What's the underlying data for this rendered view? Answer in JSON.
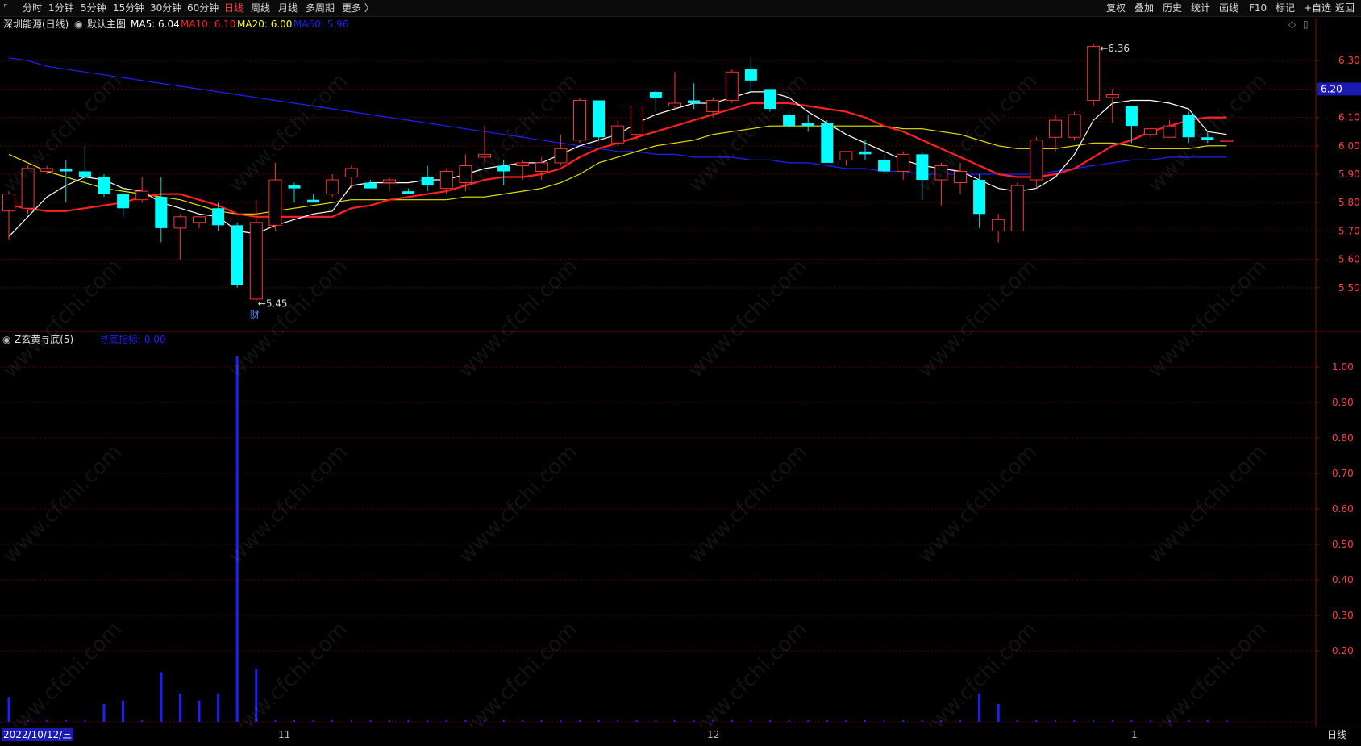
{
  "toolbar": {
    "periods": [
      "分时",
      "1分钟",
      "5分钟",
      "15分钟",
      "30分钟",
      "60分钟",
      "日线",
      "周线",
      "月线",
      "多周期",
      "更多 〉"
    ],
    "active_period": "日线",
    "right_buttons": [
      "复权",
      "叠加",
      "历史",
      "统计",
      "画线",
      "F10",
      "标记",
      "+自选",
      "返回"
    ],
    "corner_icon": "corner-marker-icon"
  },
  "main_panel": {
    "stock_name": "深圳能源(日线)",
    "template_name": "默认主图",
    "ma_labels": [
      {
        "text": "MA5: 6.04",
        "color": "#ffffff"
      },
      {
        "text": "MA10: 6.10",
        "color": "#ff2020"
      },
      {
        "text": "MA20: 6.00",
        "color": "#ffff00"
      },
      {
        "text": "MA60: 5.96",
        "color": "#1e1eff"
      }
    ],
    "price_ticks": [
      "6.30",
      "6.20",
      "6.10",
      "6.00",
      "5.90",
      "5.80",
      "5.70",
      "5.60",
      "5.50"
    ],
    "current_price": "6.20",
    "high_marker": "6.36",
    "low_marker": "5.45",
    "event_marker": "财"
  },
  "indicator_panel": {
    "title": "Z玄黄寻底(5)",
    "series_label": "寻底指标: 0.00",
    "ticks": [
      "1.00",
      "0.90",
      "0.80",
      "0.70",
      "0.60",
      "0.50",
      "0.40",
      "0.30",
      "0.20"
    ]
  },
  "bottom": {
    "start_date": "2022/10/12/三",
    "month_labels": [
      "11",
      "12",
      "1"
    ],
    "period_label": "日线"
  },
  "watermark": "www.cfchi.com",
  "colors": {
    "up": "#ff3232",
    "down": "#00ffff",
    "ma5": "#ffffff",
    "ma10": "#ff2020",
    "ma20": "#e6e600",
    "ma60": "#2020ff",
    "indicator": "#1e1eff",
    "grid": "#5a0000",
    "axis": "#8a0a0a"
  },
  "chart_data": {
    "type": "candlestick",
    "price_range": [
      5.4,
      6.4
    ],
    "indicator_range": [
      0,
      1.05
    ],
    "candles": [
      {
        "o": 5.77,
        "h": 5.84,
        "l": 5.67,
        "c": 5.83
      },
      {
        "o": 5.78,
        "h": 5.93,
        "l": 5.76,
        "c": 5.92
      },
      {
        "o": 5.91,
        "h": 5.93,
        "l": 5.9,
        "c": 5.92
      },
      {
        "o": 5.92,
        "h": 5.95,
        "l": 5.8,
        "c": 5.91
      },
      {
        "o": 5.91,
        "h": 6.0,
        "l": 5.86,
        "c": 5.89
      },
      {
        "o": 5.89,
        "h": 5.9,
        "l": 5.82,
        "c": 5.83
      },
      {
        "o": 5.83,
        "h": 5.84,
        "l": 5.75,
        "c": 5.78
      },
      {
        "o": 5.81,
        "h": 5.89,
        "l": 5.8,
        "c": 5.84
      },
      {
        "o": 5.82,
        "h": 5.89,
        "l": 5.66,
        "c": 5.71
      },
      {
        "o": 5.71,
        "h": 5.76,
        "l": 5.6,
        "c": 5.75
      },
      {
        "o": 5.73,
        "h": 5.75,
        "l": 5.71,
        "c": 5.75
      },
      {
        "o": 5.78,
        "h": 5.8,
        "l": 5.7,
        "c": 5.72
      },
      {
        "o": 5.72,
        "h": 5.73,
        "l": 5.5,
        "c": 5.51
      },
      {
        "o": 5.46,
        "h": 5.81,
        "l": 5.45,
        "c": 5.73
      },
      {
        "o": 5.72,
        "h": 5.94,
        "l": 5.7,
        "c": 5.88
      },
      {
        "o": 5.86,
        "h": 5.87,
        "l": 5.8,
        "c": 5.85
      },
      {
        "o": 5.81,
        "h": 5.83,
        "l": 5.8,
        "c": 5.8
      },
      {
        "o": 5.83,
        "h": 5.9,
        "l": 5.82,
        "c": 5.88
      },
      {
        "o": 5.89,
        "h": 5.93,
        "l": 5.85,
        "c": 5.92
      },
      {
        "o": 5.87,
        "h": 5.88,
        "l": 5.85,
        "c": 5.85
      },
      {
        "o": 5.87,
        "h": 5.89,
        "l": 5.84,
        "c": 5.88
      },
      {
        "o": 5.84,
        "h": 5.85,
        "l": 5.83,
        "c": 5.83
      },
      {
        "o": 5.89,
        "h": 5.93,
        "l": 5.84,
        "c": 5.86
      },
      {
        "o": 5.85,
        "h": 5.92,
        "l": 5.83,
        "c": 5.91
      },
      {
        "o": 5.87,
        "h": 5.97,
        "l": 5.84,
        "c": 5.93
      },
      {
        "o": 5.96,
        "h": 6.07,
        "l": 5.94,
        "c": 5.97
      },
      {
        "o": 5.93,
        "h": 5.95,
        "l": 5.86,
        "c": 5.91
      },
      {
        "o": 5.93,
        "h": 5.95,
        "l": 5.88,
        "c": 5.94
      },
      {
        "o": 5.91,
        "h": 5.96,
        "l": 5.88,
        "c": 5.94
      },
      {
        "o": 5.94,
        "h": 6.04,
        "l": 5.93,
        "c": 5.99
      },
      {
        "o": 6.02,
        "h": 6.17,
        "l": 6.01,
        "c": 6.16
      },
      {
        "o": 6.16,
        "h": 6.16,
        "l": 6.02,
        "c": 6.03
      },
      {
        "o": 6.01,
        "h": 6.09,
        "l": 6.0,
        "c": 6.07
      },
      {
        "o": 6.04,
        "h": 6.14,
        "l": 6.02,
        "c": 6.14
      },
      {
        "o": 6.19,
        "h": 6.2,
        "l": 6.12,
        "c": 6.17
      },
      {
        "o": 6.14,
        "h": 6.26,
        "l": 6.13,
        "c": 6.15
      },
      {
        "o": 6.16,
        "h": 6.22,
        "l": 6.13,
        "c": 6.15
      },
      {
        "o": 6.12,
        "h": 6.17,
        "l": 6.1,
        "c": 6.16
      },
      {
        "o": 6.16,
        "h": 6.27,
        "l": 6.15,
        "c": 6.26
      },
      {
        "o": 6.27,
        "h": 6.31,
        "l": 6.19,
        "c": 6.23
      },
      {
        "o": 6.2,
        "h": 6.2,
        "l": 6.12,
        "c": 6.13
      },
      {
        "o": 6.11,
        "h": 6.12,
        "l": 6.06,
        "c": 6.07
      },
      {
        "o": 6.08,
        "h": 6.11,
        "l": 6.05,
        "c": 6.07
      },
      {
        "o": 6.08,
        "h": 6.09,
        "l": 5.95,
        "c": 5.94
      },
      {
        "o": 5.95,
        "h": 5.98,
        "l": 5.93,
        "c": 5.98
      },
      {
        "o": 5.98,
        "h": 6.02,
        "l": 5.95,
        "c": 5.97
      },
      {
        "o": 5.95,
        "h": 5.97,
        "l": 5.9,
        "c": 5.91
      },
      {
        "o": 5.91,
        "h": 5.98,
        "l": 5.88,
        "c": 5.97
      },
      {
        "o": 5.97,
        "h": 5.98,
        "l": 5.81,
        "c": 5.88
      },
      {
        "o": 5.88,
        "h": 5.94,
        "l": 5.79,
        "c": 5.93
      },
      {
        "o": 5.87,
        "h": 5.94,
        "l": 5.83,
        "c": 5.91
      },
      {
        "o": 5.88,
        "h": 5.9,
        "l": 5.71,
        "c": 5.76
      },
      {
        "o": 5.7,
        "h": 5.76,
        "l": 5.66,
        "c": 5.74
      },
      {
        "o": 5.7,
        "h": 5.87,
        "l": 5.7,
        "c": 5.86
      },
      {
        "o": 5.88,
        "h": 6.03,
        "l": 5.85,
        "c": 6.02
      },
      {
        "o": 6.03,
        "h": 6.11,
        "l": 5.98,
        "c": 6.09
      },
      {
        "o": 6.03,
        "h": 6.12,
        "l": 6.02,
        "c": 6.11
      },
      {
        "o": 6.16,
        "h": 6.36,
        "l": 6.14,
        "c": 6.35
      },
      {
        "o": 6.17,
        "h": 6.2,
        "l": 6.08,
        "c": 6.18
      },
      {
        "o": 6.14,
        "h": 6.14,
        "l": 6.01,
        "c": 6.07
      },
      {
        "o": 6.04,
        "h": 6.06,
        "l": 6.03,
        "c": 6.06
      },
      {
        "o": 6.03,
        "h": 6.09,
        "l": 6.03,
        "c": 6.07
      },
      {
        "o": 6.11,
        "h": 6.12,
        "l": 6.01,
        "c": 6.03
      },
      {
        "o": 6.03,
        "h": 6.05,
        "l": 6.01,
        "c": 6.02
      },
      {
        "o": 6.02,
        "h": 6.02,
        "l": 6.02,
        "c": 6.02
      }
    ],
    "ma5": [
      5.68,
      5.75,
      5.82,
      5.86,
      5.89,
      5.88,
      5.85,
      5.84,
      5.8,
      5.78,
      5.76,
      5.75,
      5.7,
      5.69,
      5.72,
      5.74,
      5.76,
      5.77,
      5.86,
      5.87,
      5.87,
      5.87,
      5.88,
      5.88,
      5.9,
      5.92,
      5.93,
      5.94,
      5.94,
      5.97,
      6.0,
      6.02,
      6.04,
      6.08,
      6.11,
      6.13,
      6.15,
      6.15,
      6.17,
      6.19,
      6.19,
      6.17,
      6.12,
      6.08,
      6.04,
      6.01,
      5.98,
      5.95,
      5.93,
      5.92,
      5.91,
      5.88,
      5.85,
      5.84,
      5.85,
      5.89,
      5.97,
      6.09,
      6.15,
      6.16,
      6.16,
      6.15,
      6.13,
      6.05,
      6.04
    ],
    "ma10": [
      5.79,
      5.78,
      5.77,
      5.77,
      5.78,
      5.79,
      5.8,
      5.82,
      5.83,
      5.83,
      5.81,
      5.79,
      5.76,
      5.75,
      5.75,
      5.75,
      5.75,
      5.75,
      5.78,
      5.79,
      5.81,
      5.82,
      5.83,
      5.84,
      5.86,
      5.88,
      5.89,
      5.89,
      5.9,
      5.92,
      5.96,
      5.99,
      6.01,
      6.03,
      6.05,
      6.07,
      6.09,
      6.11,
      6.13,
      6.15,
      6.15,
      6.15,
      6.14,
      6.13,
      6.12,
      6.1,
      6.07,
      6.05,
      6.02,
      5.99,
      5.96,
      5.93,
      5.9,
      5.89,
      5.89,
      5.9,
      5.92,
      5.96,
      6.0,
      6.02,
      6.05,
      6.07,
      6.09,
      6.1,
      6.1
    ],
    "ma20": [
      5.97,
      5.94,
      5.91,
      5.89,
      5.87,
      5.85,
      5.84,
      5.83,
      5.82,
      5.81,
      5.79,
      5.77,
      5.76,
      5.76,
      5.77,
      5.78,
      5.79,
      5.8,
      5.81,
      5.81,
      5.81,
      5.81,
      5.81,
      5.81,
      5.82,
      5.82,
      5.83,
      5.84,
      5.85,
      5.87,
      5.9,
      5.94,
      5.96,
      5.98,
      6.0,
      6.01,
      6.02,
      6.04,
      6.05,
      6.06,
      6.07,
      6.07,
      6.07,
      6.07,
      6.07,
      6.07,
      6.07,
      6.06,
      6.06,
      6.05,
      6.04,
      6.02,
      6.0,
      5.99,
      5.99,
      5.99,
      6.0,
      6.01,
      6.01,
      6.0,
      5.99,
      5.99,
      5.99,
      6.0,
      6.0
    ],
    "ma60": [
      6.31,
      6.3,
      6.28,
      6.27,
      6.26,
      6.25,
      6.24,
      6.23,
      6.22,
      6.21,
      6.2,
      6.19,
      6.18,
      6.17,
      6.16,
      6.15,
      6.14,
      6.13,
      6.12,
      6.11,
      6.1,
      6.09,
      6.08,
      6.07,
      6.06,
      6.05,
      6.04,
      6.03,
      6.02,
      6.01,
      6.0,
      5.99,
      5.98,
      5.98,
      5.97,
      5.97,
      5.96,
      5.96,
      5.96,
      5.95,
      5.95,
      5.94,
      5.94,
      5.93,
      5.92,
      5.92,
      5.91,
      5.91,
      5.9,
      5.9,
      5.9,
      5.9,
      5.9,
      5.9,
      5.9,
      5.91,
      5.92,
      5.93,
      5.94,
      5.95,
      5.95,
      5.96,
      5.96,
      5.96,
      5.96
    ],
    "indicator": [
      0.07,
      0,
      0,
      0,
      0,
      0.05,
      0.06,
      0,
      0.14,
      0.08,
      0.06,
      0.08,
      1.03,
      0.15,
      0,
      0,
      0,
      0,
      0,
      0,
      0,
      0,
      0,
      0,
      0,
      0,
      0,
      0,
      0,
      0,
      0,
      0,
      0,
      0,
      0,
      0,
      0,
      0,
      0,
      0,
      0,
      0,
      0,
      0,
      0,
      0,
      0,
      0,
      0,
      0,
      0,
      0.08,
      0.05,
      0,
      0,
      0,
      0,
      0,
      0,
      0,
      0,
      0,
      0,
      0,
      0
    ]
  }
}
